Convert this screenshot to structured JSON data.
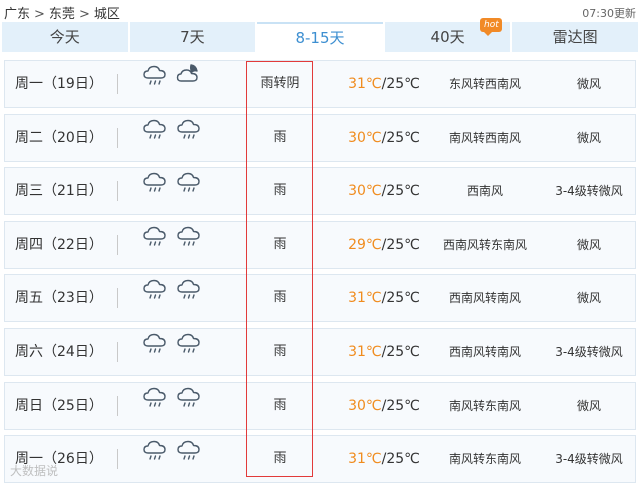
{
  "breadcrumb": {
    "province": "广东",
    "city": "东莞",
    "district": "城区",
    "separator": ">"
  },
  "update_time": "07:30更新",
  "tabs": [
    {
      "label": "今天",
      "active": false
    },
    {
      "label": "7天",
      "active": false
    },
    {
      "label": "8-15天",
      "active": true
    },
    {
      "label": "40天",
      "active": false,
      "badge": "hot"
    },
    {
      "label": "雷达图",
      "active": false
    }
  ],
  "accent_color": "#3d8fd1",
  "high_temp_color": "#f08c1e",
  "highlight_color": "#e23a3a",
  "days": [
    {
      "day": "周一（19日）",
      "icons": [
        "rain-cloud-icon",
        "cloud-moon-icon"
      ],
      "condition": "雨转阴",
      "high": "31℃",
      "low": "/25℃",
      "wind": "东风转西南风",
      "level": "微风"
    },
    {
      "day": "周二（20日）",
      "icons": [
        "rain-cloud-icon",
        "rain-cloud-icon"
      ],
      "condition": "雨",
      "high": "30℃",
      "low": "/25℃",
      "wind": "南风转西南风",
      "level": "微风"
    },
    {
      "day": "周三（21日）",
      "icons": [
        "rain-cloud-icon",
        "rain-cloud-icon"
      ],
      "condition": "雨",
      "high": "30℃",
      "low": "/25℃",
      "wind": "西南风",
      "level": "3-4级转微风"
    },
    {
      "day": "周四（22日）",
      "icons": [
        "rain-cloud-icon",
        "rain-cloud-icon"
      ],
      "condition": "雨",
      "high": "29℃",
      "low": "/25℃",
      "wind": "西南风转东南风",
      "level": "微风"
    },
    {
      "day": "周五（23日）",
      "icons": [
        "rain-cloud-icon",
        "rain-cloud-icon"
      ],
      "condition": "雨",
      "high": "31℃",
      "low": "/25℃",
      "wind": "西南风转南风",
      "level": "微风"
    },
    {
      "day": "周六（24日）",
      "icons": [
        "rain-cloud-icon",
        "rain-cloud-icon"
      ],
      "condition": "雨",
      "high": "31℃",
      "low": "/25℃",
      "wind": "西南风转南风",
      "level": "3-4级转微风"
    },
    {
      "day": "周日（25日）",
      "icons": [
        "rain-cloud-icon",
        "rain-cloud-icon"
      ],
      "condition": "雨",
      "high": "30℃",
      "low": "/25℃",
      "wind": "南风转东南风",
      "level": "微风"
    },
    {
      "day": "周一（26日）",
      "icons": [
        "rain-cloud-icon",
        "rain-cloud-icon"
      ],
      "condition": "雨",
      "high": "31℃",
      "low": "/25℃",
      "wind": "南风转东南风",
      "level": "3-4级转微风"
    }
  ],
  "watermark": "大数据说"
}
